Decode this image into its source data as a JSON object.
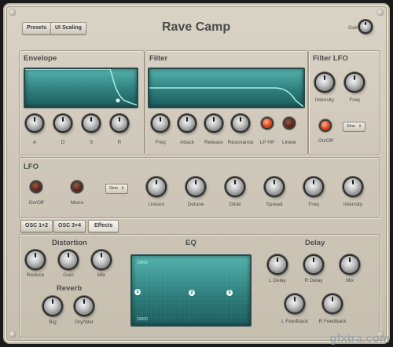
{
  "header": {
    "presets_label": "Presets",
    "ui_scaling_label": "UI Scaling",
    "title": "Rave Camp",
    "gain_label": "Gain"
  },
  "envelope": {
    "title": "Envelope",
    "knobs": [
      "A",
      "D",
      "S",
      "R"
    ]
  },
  "filter": {
    "title": "Filter",
    "knobs": [
      "Freq",
      "Attack",
      "Release",
      "Resonance"
    ],
    "toggles": [
      "LP HP",
      "Linear"
    ]
  },
  "filter_lfo": {
    "title": "Filter LFO",
    "knobs": [
      "Intensity",
      "Freq"
    ],
    "onoff_label": "On/Off",
    "wave_select": "Sine"
  },
  "lfo": {
    "title": "LFO",
    "onoff_label": "On/Off",
    "mono_label": "Mono",
    "wave_select": "Sine",
    "knobs": [
      "Unison",
      "Detune",
      "Glide",
      "Spread",
      "Freq",
      "Intensity"
    ]
  },
  "tabs": [
    "OSC 1+2",
    "OSC 3+4",
    "Effects"
  ],
  "distortion": {
    "title": "Distortion",
    "knobs": [
      "Reduce",
      "Gain",
      "Mix"
    ]
  },
  "reverb": {
    "title": "Reverb",
    "knobs": [
      "Big",
      "Dry/Wet"
    ]
  },
  "eq": {
    "title": "EQ",
    "top_label": "10000",
    "bottom_label": "10000",
    "nodes": [
      "1",
      "2",
      "3"
    ]
  },
  "delay": {
    "title": "Delay",
    "knobs": [
      "L Delay",
      "R Delay",
      "Mix",
      "L Feedback",
      "R Feedback"
    ]
  },
  "watermark": "gfxtra.com"
}
